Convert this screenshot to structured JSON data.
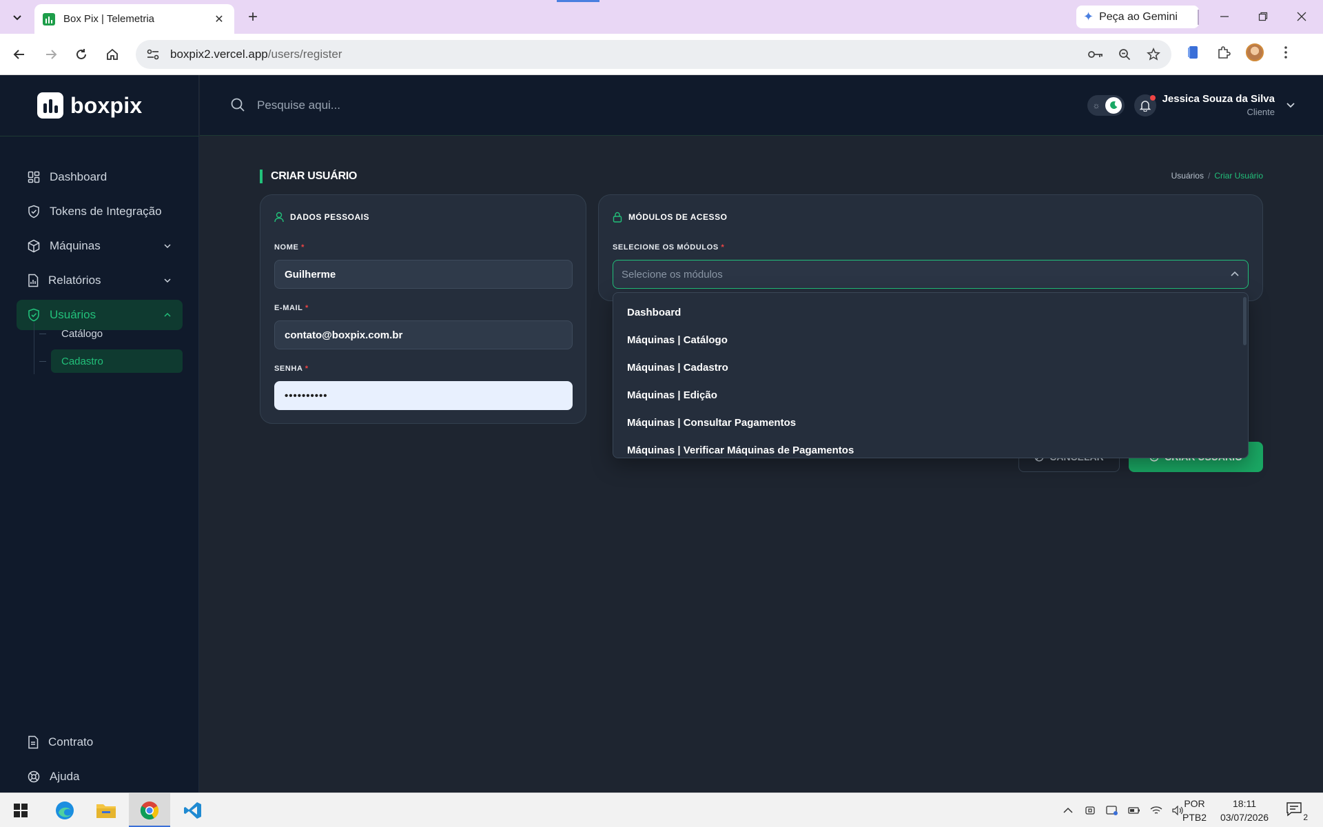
{
  "browser": {
    "tab_title": "Box Pix | Telemetria",
    "gemini_label": "Peça ao Gemini",
    "url_host": "boxpix2.vercel.app",
    "url_path": "/users/register"
  },
  "sidebar": {
    "logo_text": "boxpix",
    "items": [
      {
        "label": "Dashboard",
        "icon": "dashboard-icon"
      },
      {
        "label": "Tokens de Integração",
        "icon": "shield-icon"
      },
      {
        "label": "Máquinas",
        "icon": "box-icon"
      },
      {
        "label": "Relatórios",
        "icon": "report-icon"
      },
      {
        "label": "Usuários",
        "icon": "shield-check-icon"
      }
    ],
    "sub_items": [
      {
        "label": "Catálogo"
      },
      {
        "label": "Cadastro"
      }
    ],
    "bottom": [
      {
        "label": "Contrato",
        "icon": "document-icon"
      },
      {
        "label": "Ajuda",
        "icon": "help-icon"
      }
    ]
  },
  "topbar": {
    "search_placeholder": "Pesquise aqui...",
    "user_name": "Jessica Souza da Silva",
    "user_role": "Cliente"
  },
  "page": {
    "title": "CRIAR USUÁRIO",
    "breadcrumb": [
      "Usuários",
      "Criar Usuário"
    ],
    "accent": "#22c07a"
  },
  "personal": {
    "header": "DADOS PESSOAIS",
    "name_label": "NOME",
    "name_value": "Guilherme",
    "email_label": "E-MAIL",
    "email_value": "contato@boxpix.com.br",
    "password_label": "SENHA",
    "password_value": "••••••••••"
  },
  "modules": {
    "header": "MÓDULOS DE ACESSO",
    "select_label": "SELECIONE OS MÓDULOS",
    "select_placeholder": "Selecione os módulos",
    "options": [
      "Dashboard",
      "Máquinas | Catálogo",
      "Máquinas | Cadastro",
      "Máquinas | Edição",
      "Máquinas | Consultar Pagamentos",
      "Máquinas | Verificar Máquinas de Pagamentos"
    ]
  },
  "actions": {
    "cancel_label": "CANCELAR",
    "create_label": "CRIAR USUÁRIO"
  },
  "taskbar": {
    "lang_top": "POR",
    "lang_bottom": "PTB2",
    "time": "18:11",
    "date": "03/07/2026",
    "notifications": "2"
  }
}
